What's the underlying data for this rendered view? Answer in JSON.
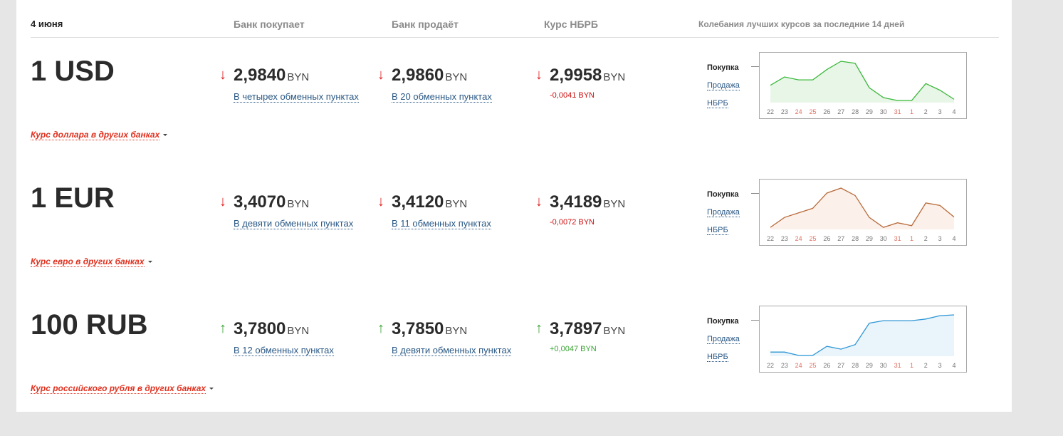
{
  "header": {
    "date": "4 июня",
    "buy": "Банк покупает",
    "sell": "Банк продаёт",
    "nbrb": "Курс НБРБ",
    "chart_title": "Колебания лучших курсов за последние 14 дней"
  },
  "chart_legend": {
    "buy": "Покупка",
    "sell": "Продажа",
    "nbrb": "НБРБ"
  },
  "days": [
    {
      "label": "22",
      "weekend": false
    },
    {
      "label": "23",
      "weekend": false
    },
    {
      "label": "24",
      "weekend": true
    },
    {
      "label": "25",
      "weekend": true
    },
    {
      "label": "26",
      "weekend": false
    },
    {
      "label": "27",
      "weekend": false
    },
    {
      "label": "28",
      "weekend": false
    },
    {
      "label": "29",
      "weekend": false
    },
    {
      "label": "30",
      "weekend": false
    },
    {
      "label": "31",
      "weekend": true
    },
    {
      "label": "1",
      "weekend": true
    },
    {
      "label": "2",
      "weekend": false
    },
    {
      "label": "3",
      "weekend": false
    },
    {
      "label": "4",
      "weekend": false
    }
  ],
  "colors": {
    "down": "#e02020",
    "up": "#3aa535",
    "link": "#2a5885",
    "other_banks": "#e0301e",
    "weekend_tick": "#e07060"
  },
  "rates": [
    {
      "currency": "1 USD",
      "buy": {
        "value": "2,9840",
        "unit": "BYN",
        "dir": "down",
        "link": "В четырех обменных пунктах"
      },
      "sell": {
        "value": "2,9860",
        "unit": "BYN",
        "dir": "down",
        "link": "В 20 обменных пунктах"
      },
      "nbrb": {
        "value": "2,9958",
        "unit": "BYN",
        "dir": "down",
        "change": "-0,0041 BYN"
      },
      "other_banks": "Курс доллара в других банках",
      "chart_color": "#3cb83c",
      "chart_fill": "#e8f6e8"
    },
    {
      "currency": "1 EUR",
      "buy": {
        "value": "3,4070",
        "unit": "BYN",
        "dir": "down",
        "link": "В девяти обменных пунктах"
      },
      "sell": {
        "value": "3,4120",
        "unit": "BYN",
        "dir": "down",
        "link": "В 11 обменных пунктах"
      },
      "nbrb": {
        "value": "3,4189",
        "unit": "BYN",
        "dir": "down",
        "change": "-0,0072 BYN"
      },
      "other_banks": "Курс евро в других банках",
      "chart_color": "#b86a3a",
      "chart_fill": "#fbf0ea"
    },
    {
      "currency": "100 RUB",
      "buy": {
        "value": "3,7800",
        "unit": "BYN",
        "dir": "up",
        "link": "В 12 обменных пунктах"
      },
      "sell": {
        "value": "3,7850",
        "unit": "BYN",
        "dir": "up",
        "link": "В девяти обменных пунктах"
      },
      "nbrb": {
        "value": "3,7897",
        "unit": "BYN",
        "dir": "up",
        "change": "+0,0047 BYN"
      },
      "other_banks": "Курс российского рубля в других банках",
      "chart_color": "#2f97d6",
      "chart_fill": "#eaf4fb"
    }
  ],
  "chart_data": [
    {
      "type": "line",
      "categories": [
        "22",
        "23",
        "24",
        "25",
        "26",
        "27",
        "28",
        "29",
        "30",
        "31",
        "1",
        "2",
        "3",
        "4"
      ],
      "series": [
        {
          "values": [
            0.42,
            0.62,
            0.55,
            0.55,
            0.8,
            1.0,
            0.95,
            0.36,
            0.12,
            0.05,
            0.05,
            0.46,
            0.3,
            0.08
          ]
        }
      ]
    },
    {
      "type": "line",
      "categories": [
        "22",
        "23",
        "24",
        "25",
        "26",
        "27",
        "28",
        "29",
        "30",
        "31",
        "1",
        "2",
        "3",
        "4"
      ],
      "series": [
        {
          "values": [
            0.05,
            0.29,
            0.4,
            0.51,
            0.88,
            1.0,
            0.82,
            0.29,
            0.05,
            0.16,
            0.09,
            0.64,
            0.58,
            0.3
          ]
        }
      ]
    },
    {
      "type": "line",
      "categories": [
        "22",
        "23",
        "24",
        "25",
        "26",
        "27",
        "28",
        "29",
        "30",
        "31",
        "1",
        "2",
        "3",
        "4"
      ],
      "series": [
        {
          "values": [
            0.1,
            0.1,
            0.02,
            0.02,
            0.24,
            0.17,
            0.28,
            0.8,
            0.86,
            0.86,
            0.86,
            0.9,
            0.98,
            1.0
          ]
        }
      ]
    }
  ]
}
